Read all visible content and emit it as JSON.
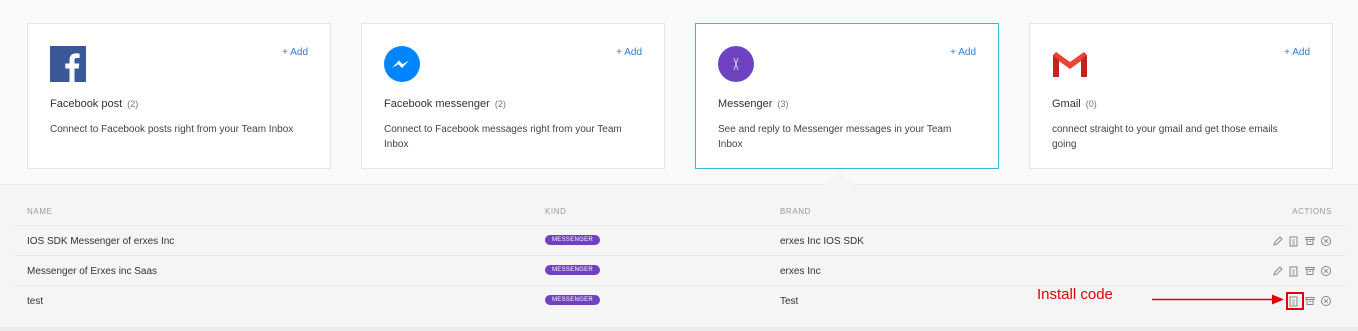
{
  "integrations": [
    {
      "name": "Facebook post",
      "count": "(2)",
      "desc": "Connect to Facebook posts right from your Team Inbox",
      "add": "+ Add",
      "icon": "facebook-icon"
    },
    {
      "name": "Facebook messenger",
      "count": "(2)",
      "desc": "Connect to Facebook messages right from your Team Inbox",
      "add": "+ Add",
      "icon": "messenger-icon"
    },
    {
      "name": "Messenger",
      "count": "(3)",
      "desc": "See and reply to Messenger messages in your Team Inbox",
      "add": "+ Add",
      "icon": "erxes-messenger-icon"
    },
    {
      "name": "Gmail",
      "count": "(0)",
      "desc": "connect straight to your gmail and get those emails going",
      "add": "+ Add",
      "icon": "gmail-icon"
    }
  ],
  "table": {
    "headers": {
      "name": "NAME",
      "kind": "KIND",
      "brand": "BRAND",
      "actions": "ACTIONS"
    },
    "rows": [
      {
        "name": "IOS SDK Messenger of erxes Inc",
        "kind": "MESSENGER",
        "brand": "erxes Inc IOS SDK"
      },
      {
        "name": "Messenger of Erxes inc Saas",
        "kind": "MESSENGER",
        "brand": "erxes Inc"
      },
      {
        "name": "test",
        "kind": "MESSENGER",
        "brand": "Test"
      }
    ]
  },
  "annotation": {
    "label": "Install code",
    "color": "#e00000"
  },
  "colors": {
    "accent": "#2b7fd6",
    "badge": "#6f42c1",
    "active_border": "#37b8d9"
  }
}
